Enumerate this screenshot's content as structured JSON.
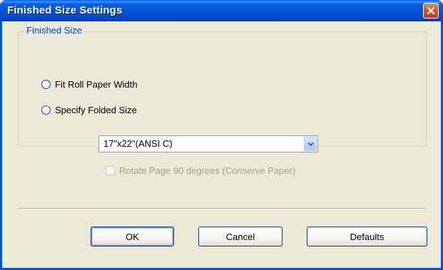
{
  "window": {
    "title": "Finished Size Settings",
    "close_icon": "close-icon",
    "accent_color": "#0553d8"
  },
  "finished_size": {
    "group_label": "Finished Size",
    "option_fit": "Fit Roll Paper Width",
    "option_specify": "Specify Folded Size",
    "paper_size_selected": "17\"x22\"(ANSI C)",
    "rotate_label": "Rotate Page 90 degrees (Conserve Paper)",
    "rotate_checked": false,
    "rotate_disabled": true
  },
  "buttons": {
    "ok": "OK",
    "cancel": "Cancel",
    "defaults": "Defaults"
  }
}
